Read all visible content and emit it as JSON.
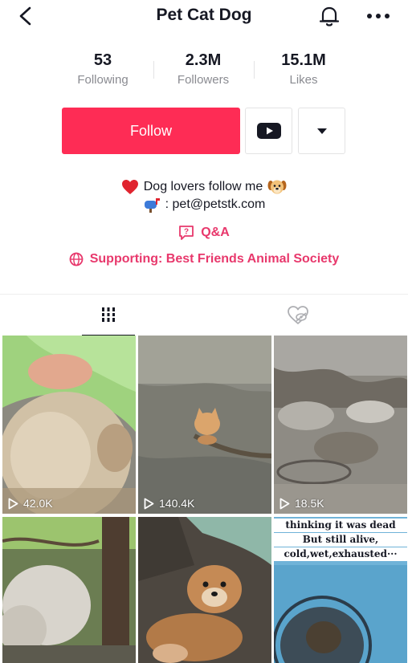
{
  "header": {
    "title": "Pet Cat Dog",
    "back_icon": "chevron-left-icon",
    "bell_icon": "bell-icon",
    "more_icon": "more-horizontal-icon"
  },
  "stats": [
    {
      "value": "53",
      "label": "Following"
    },
    {
      "value": "2.3M",
      "label": "Followers"
    },
    {
      "value": "15.1M",
      "label": "Likes"
    }
  ],
  "actions": {
    "follow_label": "Follow",
    "youtube_icon": "youtube-icon",
    "dropdown_icon": "caret-down-icon",
    "follow_color": "#fe2c55"
  },
  "bio": {
    "line1": "Dog lovers follow me",
    "line2": ": pet@petstk.com",
    "line1_lead_icon": "red-heart-emoji",
    "line1_trail_icon": "dog-face-emoji",
    "line2_lead_icon": "mailbox-emoji"
  },
  "links": {
    "qa": "Q&A",
    "supporting": "Supporting: Best Friends Animal Society",
    "accent_color": "#e8386c"
  },
  "tabs": {
    "videos_icon": "grid-icon",
    "liked_icon": "heart-hidden-icon"
  },
  "videos": [
    {
      "views": "42.0K",
      "icon": "play-icon"
    },
    {
      "views": "140.4K",
      "icon": "play-icon"
    },
    {
      "views": "18.5K",
      "icon": "play-icon"
    },
    {
      "views": ""
    },
    {
      "views": ""
    },
    {
      "views": "",
      "caption_line1": "thinking it was dead",
      "caption_line2": "But still alive,",
      "caption_line3": "cold,wet,exhausted···"
    }
  ]
}
